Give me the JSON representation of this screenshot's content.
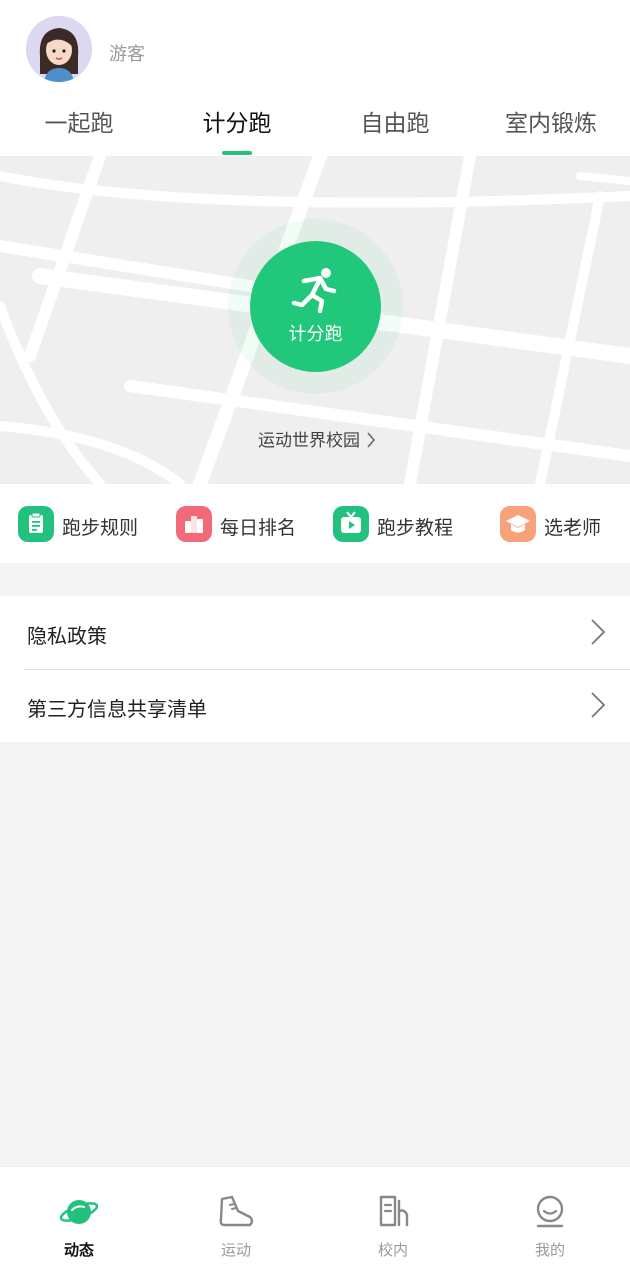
{
  "user": {
    "name": "游客",
    "avatar_icon": "user-avatar"
  },
  "tabs": [
    {
      "label": "一起跑",
      "active": false
    },
    {
      "label": "计分跑",
      "active": true
    },
    {
      "label": "自由跑",
      "active": false
    },
    {
      "label": "室内锻炼",
      "active": false
    }
  ],
  "map": {
    "start_button_label": "计分跑",
    "start_icon": "runner-icon",
    "campus_link": "运动世界校园"
  },
  "quick_actions": [
    {
      "label": "跑步规则",
      "icon": "clipboard-icon",
      "color": "#22c17e"
    },
    {
      "label": "每日排名",
      "icon": "ranking-icon",
      "color": "#f06a7a"
    },
    {
      "label": "跑步教程",
      "icon": "video-icon",
      "color": "#22c17e"
    },
    {
      "label": "选老师",
      "icon": "graduation-cap-icon",
      "color": "#f7a27a"
    }
  ],
  "menu": [
    {
      "label": "隐私政策"
    },
    {
      "label": "第三方信息共享清单"
    }
  ],
  "bottom_nav": [
    {
      "label": "动态",
      "icon": "planet-icon",
      "active": true
    },
    {
      "label": "运动",
      "icon": "sneaker-icon",
      "active": false
    },
    {
      "label": "校内",
      "icon": "campus-icon",
      "active": false
    },
    {
      "label": "我的",
      "icon": "profile-icon",
      "active": false
    }
  ],
  "colors": {
    "accent": "#22c17e",
    "background": "#f4f4f4"
  }
}
